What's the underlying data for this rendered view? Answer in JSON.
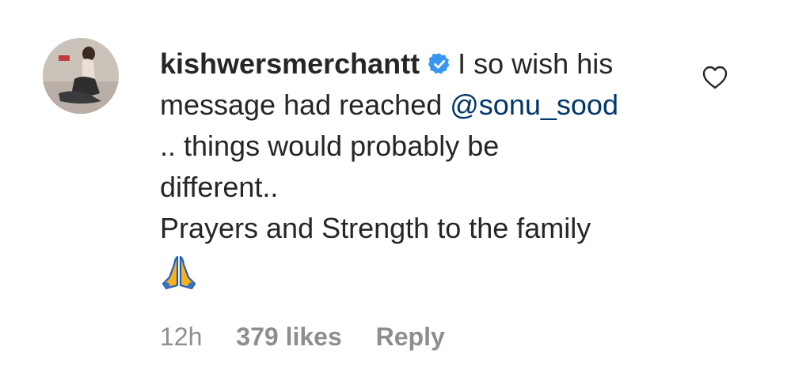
{
  "comment": {
    "username": "kishwersmerchantt",
    "verified": true,
    "text_part1": "I so wish his",
    "text_part2": "message had reached",
    "mention": "@sonu_sood",
    "text_part3": ".. things would probably be",
    "text_part4": "different..",
    "text_part5": "Prayers and Strength to the family",
    "emoji": "folded-hands",
    "time": "12h",
    "likes": "379 likes",
    "reply_label": "Reply"
  },
  "icons": {
    "verified": "verified-badge-icon",
    "like": "heart-outline-icon"
  },
  "colors": {
    "text": "#262626",
    "meta": "#8e8e8e",
    "mention": "#00376b",
    "verified": "#3897f0"
  }
}
